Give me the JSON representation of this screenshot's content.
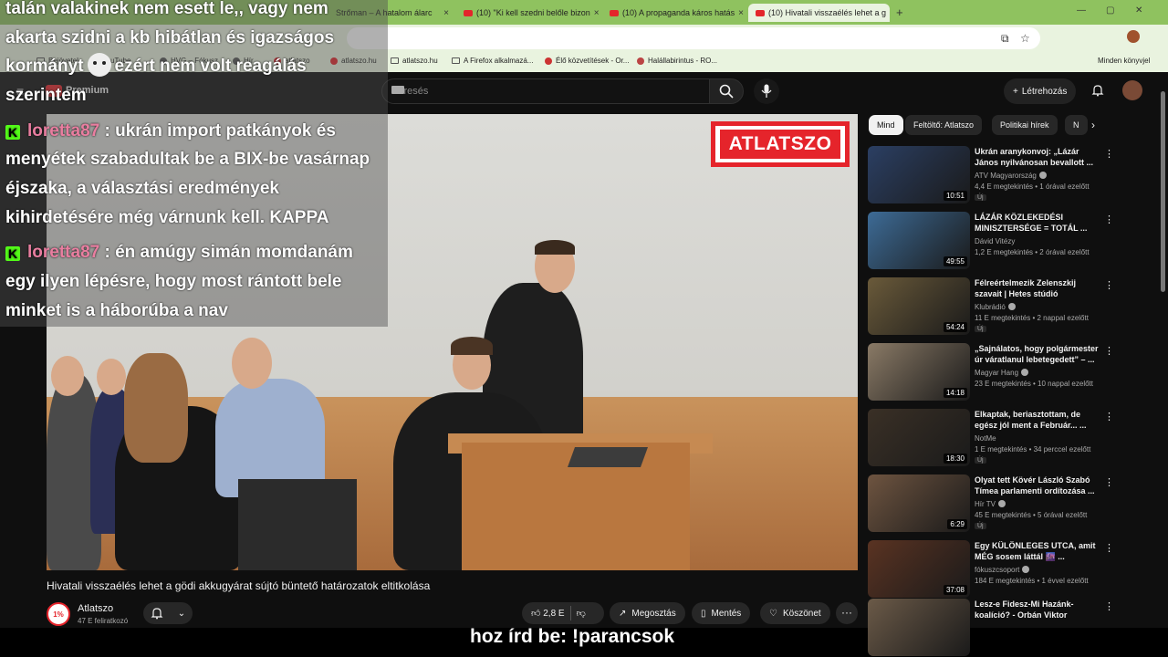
{
  "browser": {
    "tabs": [
      {
        "title": "Strőman – A hatalom álarc"
      },
      {
        "title": "(10) \"Ki kell szedni belőle bizon"
      },
      {
        "title": "(10) A propaganda káros hatás"
      },
      {
        "title": "(10) Hivatali visszaélés lehet a g"
      }
    ],
    "new_tab": "+",
    "bookmarks": [
      {
        "label": "Bejövetel"
      },
      {
        "label": "YouTube"
      },
      {
        "label": "HVG – Fókusz"
      },
      {
        "label": "Hír"
      },
      {
        "label": "atlatszo"
      },
      {
        "label": "atlatszo.hu"
      },
      {
        "label": "atlatszo.hu"
      },
      {
        "label": "A Firefox alkalmazá..."
      },
      {
        "label": "Élő közvetítések - Or..."
      },
      {
        "label": "Halállabirintus - RO..."
      },
      {
        "label": "Minden könyvjel"
      }
    ]
  },
  "youtube": {
    "logo_text": "Premium",
    "search_placeholder": "Keresés",
    "create_label": "Létrehozás"
  },
  "chat": {
    "lines": [
      {
        "text": "talán valakinek nem esett le,, vagy nem"
      },
      {
        "text": "akarta szidni a kb hibátlan és igazságos"
      },
      {
        "pre": "kormányt",
        "post": "ezért nem volt reagálás"
      },
      {
        "text": "szerintem"
      },
      {
        "user": "loretta87",
        "text": ": ukrán import patkányok és"
      },
      {
        "text": "menyétek szabadultak be a BIX-be vasárnap"
      },
      {
        "text": "éjszaka, a választási eredmények"
      },
      {
        "text": "kihirdetésére még várnunk kell. KAPPA"
      },
      {
        "user": "loretta87",
        "text": ": én amúgy simán momdanám"
      },
      {
        "text": "egy ilyen lépésre, hogy most rántott bele"
      },
      {
        "text": "minket is a háborúba a nav"
      }
    ],
    "platform_icon": "K"
  },
  "video": {
    "watermark": "ATLATSZO",
    "title": "Hivatali visszaélés lehet a gödi akkugyárat sújtó büntető határozatok eltitkolása",
    "channel": "Atlatszo",
    "channel_badge": "1%",
    "subscribers": "47 E feliratkozó",
    "likes": "2,8 E",
    "share_label": "Megosztás",
    "save_label": "Mentés",
    "thanks_label": "Köszönet",
    "more": "···"
  },
  "subtitle": "hoz írd be: !parancsok",
  "sidebar": {
    "chips": [
      "Mind",
      "Feltöltő: Atlatszo",
      "Politikai hírek",
      "N"
    ],
    "items": [
      {
        "title": "Ukrán aranykonvoj: „Lázár János nyilvánosan bevallott ...",
        "channel": "ATV Magyarország",
        "verified": true,
        "meta": "4,4 E megtekintés • 1 órával ezelőtt",
        "badge": "Új",
        "duration": "10:51",
        "thumb_color": "#2b3f63"
      },
      {
        "title": "LÁZÁR KÖZLEKEDÉSI MINISZTERSÉGE = TOTÁL ...",
        "channel": "Dávid Vitézy",
        "verified": false,
        "meta": "1,2 E megtekintés • 2 órával ezelőtt",
        "badge": "",
        "duration": "49:55",
        "thumb_color": "#3d6b96"
      },
      {
        "title": "Félreértelmezik Zelenszkij szavait | Hetes stúdió",
        "channel": "Klubrádió",
        "verified": true,
        "meta": "11 E megtekintés • 2 nappal ezelőtt",
        "badge": "Új",
        "duration": "54:24",
        "thumb_color": "#6a5a3a"
      },
      {
        "title": "„Sajnálatos, hogy polgármester úr váratlanul lebetegedett” – ...",
        "channel": "Magyar Hang",
        "verified": true,
        "meta": "23 E megtekintés • 10 nappal ezelőtt",
        "badge": "",
        "duration": "14:18",
        "thumb_color": "#8a7a66"
      },
      {
        "title": "Elkaptak, beriasztottam, de egész jól ment a Február... ...",
        "channel": "NotMe",
        "verified": false,
        "meta": "1 E megtekintés • 34 perccel ezelőtt",
        "badge": "Új",
        "duration": "18:30",
        "thumb_color": "#3a3026"
      },
      {
        "title": "Olyat tett Kövér László Szabó Tímea parlamenti ordítozása ...",
        "channel": "Hír TV",
        "verified": true,
        "meta": "45 E megtekintés • 5 órával ezelőtt",
        "badge": "Új",
        "duration": "6:29",
        "thumb_color": "#6e5440"
      },
      {
        "title": "Egy KÜLÖNLEGES UTCA, amit MÉG sosem láttál 🌆 ...",
        "channel": "fókuszcsoport",
        "verified": true,
        "meta": "184 E megtekintés • 1 évvel ezelőtt",
        "badge": "",
        "duration": "37:08",
        "thumb_color": "#5a3322"
      },
      {
        "title": "Lesz-e Fidesz-Mi Hazánk-koalíció? - Orbán Viktor válasz...",
        "channel": "",
        "verified": false,
        "meta": "",
        "badge": "",
        "duration": "",
        "thumb_color": "#6b5a48"
      }
    ]
  }
}
